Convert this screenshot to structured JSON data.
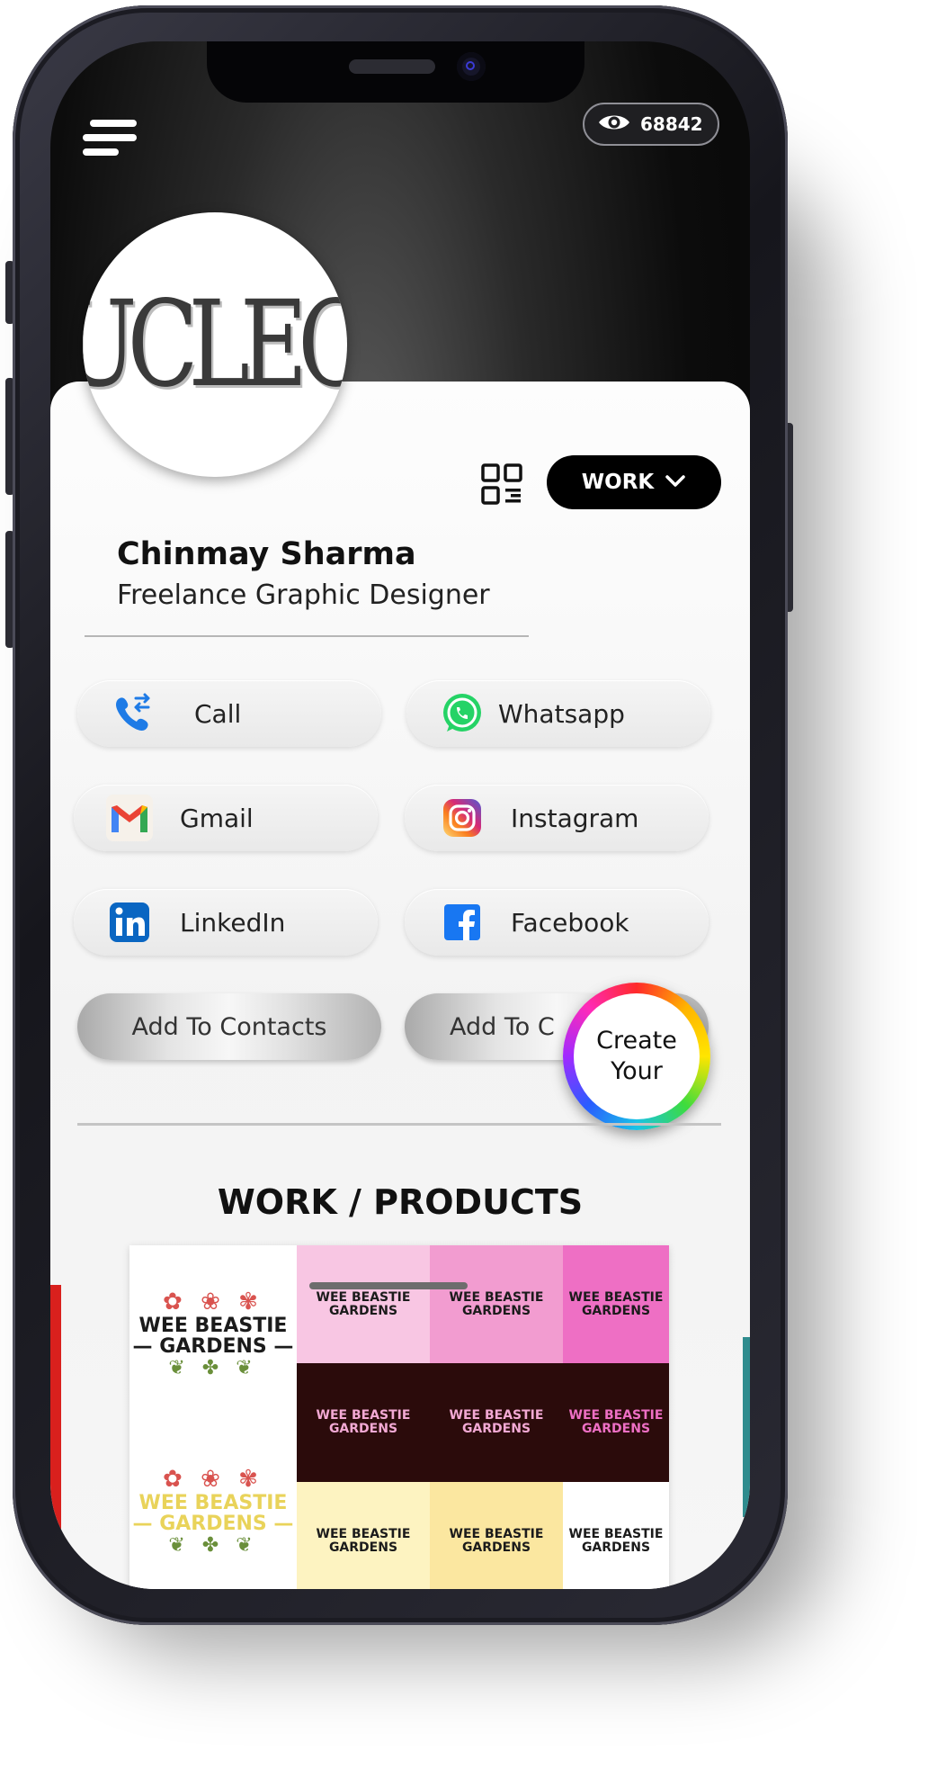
{
  "status": {
    "view_count": "68842"
  },
  "profile": {
    "logo_text": "UCLEO",
    "name": "Chinmay Sharma",
    "title": "Freelance Graphic Designer",
    "category_button": "WORK"
  },
  "actions": [
    {
      "label": "Call",
      "icon": "phone-icon"
    },
    {
      "label": "Whatsapp",
      "icon": "whatsapp-icon"
    },
    {
      "label": "Gmail",
      "icon": "gmail-icon"
    },
    {
      "label": "Instagram",
      "icon": "instagram-icon"
    },
    {
      "label": "LinkedIn",
      "icon": "linkedin-icon"
    },
    {
      "label": "Facebook",
      "icon": "facebook-icon"
    }
  ],
  "contacts": {
    "add_to_contacts": "Add To Contacts",
    "add_to_second": "Add To C"
  },
  "create_badge": {
    "line1": "Create",
    "line2": "Your"
  },
  "section": {
    "title": "WORK / PRODUCTS"
  },
  "gallery": {
    "main_tiles": [
      {
        "text": "WEE BEASTIE\n— GARDENS —",
        "color": "#1b1b1b"
      },
      {
        "text": "WEE BEASTIE\n— GARDENS —",
        "color": "#e9d35a"
      }
    ],
    "grid_tiles": [
      {
        "bg": "#f8c6e3",
        "text": "WEE BEASTIE\nGARDENS",
        "color": "#1b1b1b"
      },
      {
        "bg": "#f29cd0",
        "text": "WEE BEASTIE\nGARDENS",
        "color": "#1b1b1b"
      },
      {
        "bg": "#ee6fc4",
        "text": "WEE BEASTIE\nGARDENS",
        "color": "#1b1b1b"
      },
      {
        "bg": "#2b0b0b",
        "text": "WEE BEASTIE\nGARDENS",
        "color": "#f3a9d4"
      },
      {
        "bg": "#2b0b0b",
        "text": "WEE BEASTIE\nGARDENS",
        "color": "#f3a9d4"
      },
      {
        "bg": "#2b0b0b",
        "text": "WEE BEASTIE\nGARDENS",
        "color": "#ee6fc4"
      },
      {
        "bg": "#fdf3c1",
        "text": "WEE BEASTIE\nGARDENS",
        "color": "#1b1b1b"
      },
      {
        "bg": "#fbe7a0",
        "text": "WEE BEASTIE\nGARDENS",
        "color": "#1b1b1b"
      },
      {
        "bg": "#ffffff",
        "text": "WEE BEASTIE\nGARDENS",
        "color": "#1b1b1b"
      }
    ]
  },
  "colors": {
    "accent_black": "#000000",
    "card_bg": "#f6f6f6",
    "call_blue": "#1e7be6",
    "whatsapp_green": "#25d366",
    "linkedin_blue": "#0a66c2",
    "facebook_blue": "#1877f2"
  }
}
